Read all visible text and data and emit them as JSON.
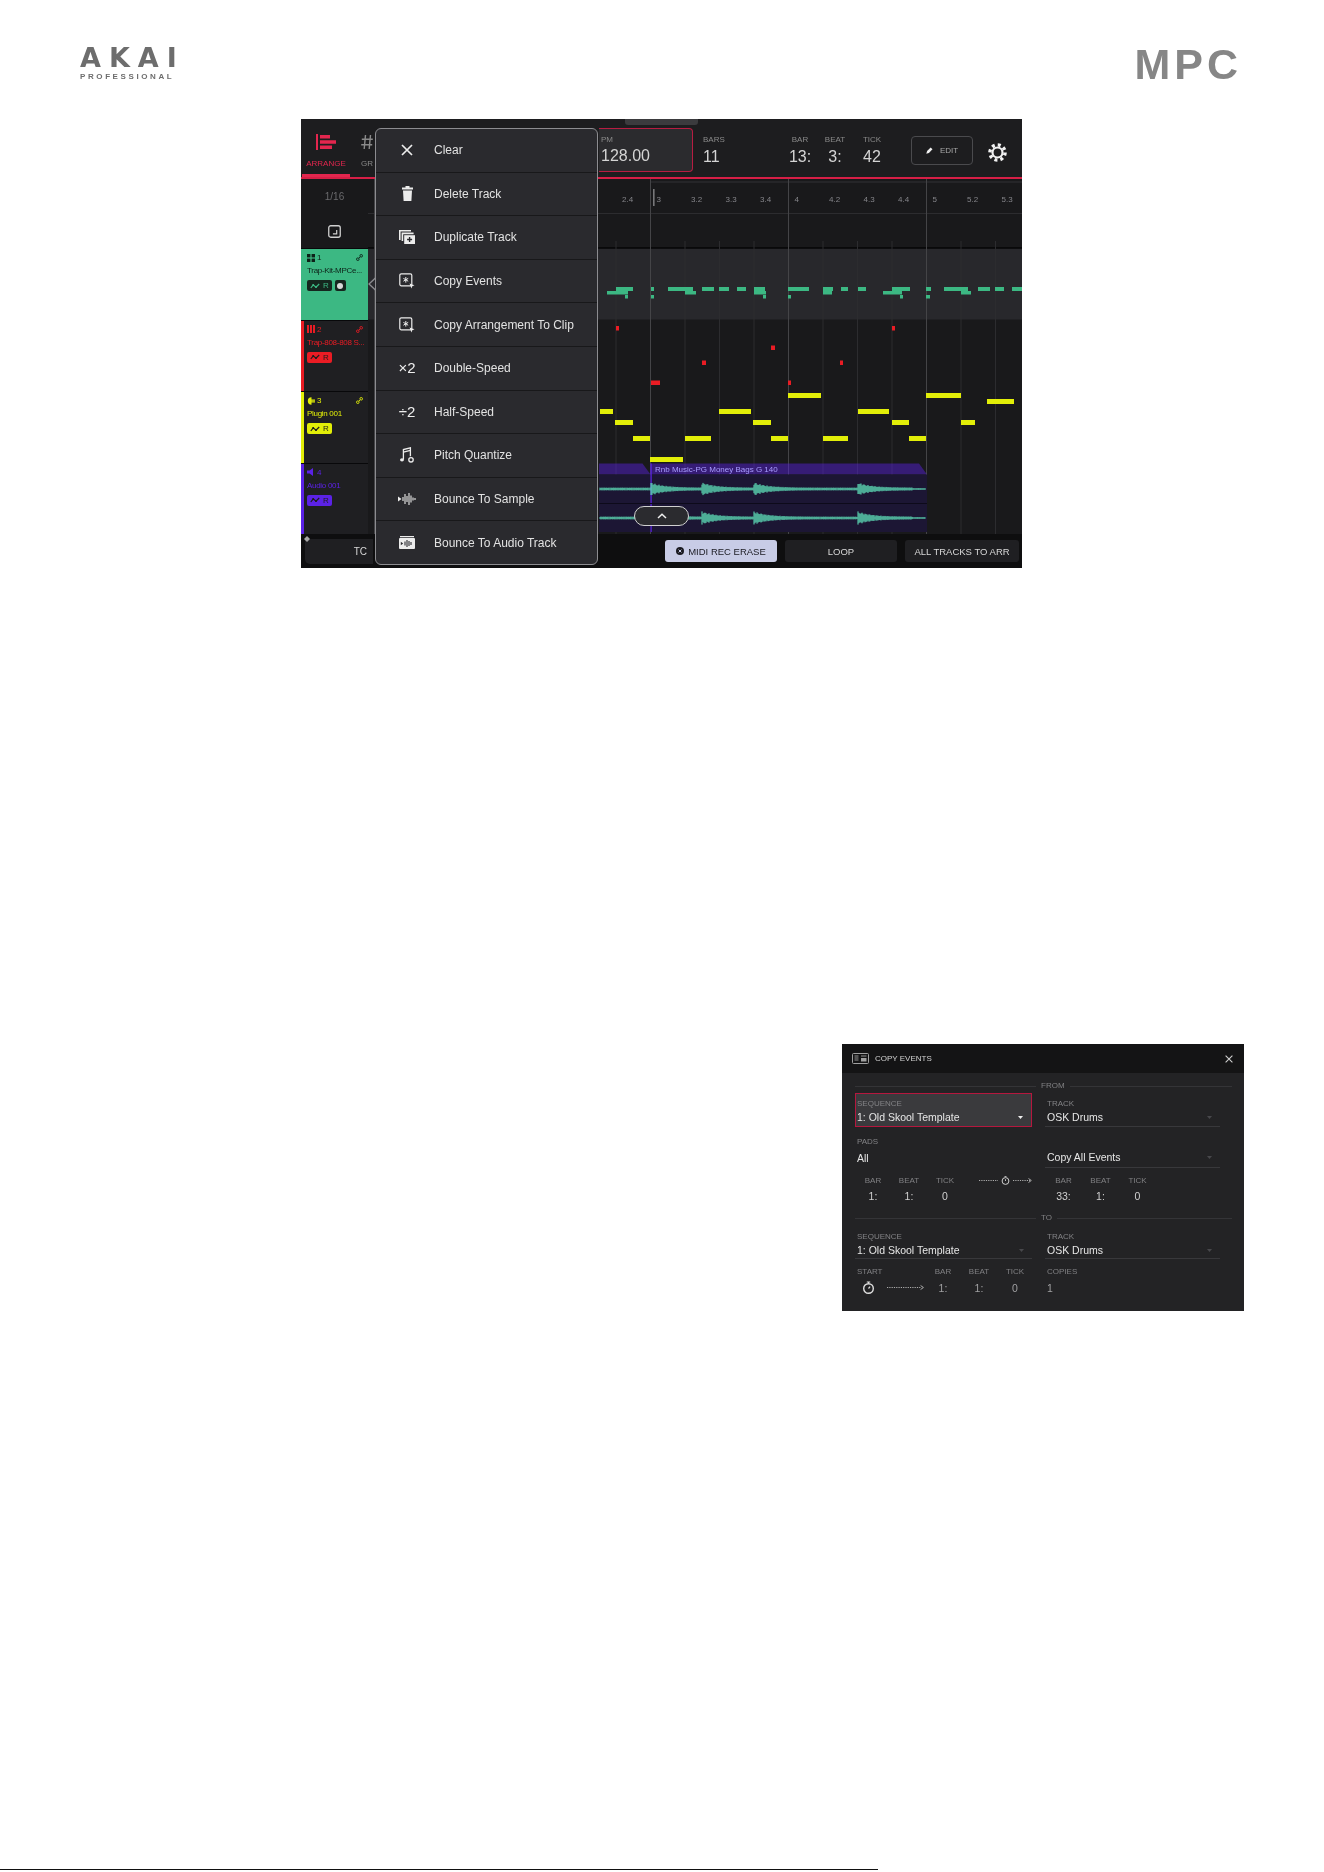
{
  "header": {
    "brand_logo": {
      "name": "AKAI",
      "subtitle": "PROFESSIONAL"
    },
    "product_logo": "MPC"
  },
  "arrange_screen": {
    "tabs": [
      {
        "label": "ARRANGE",
        "selected": true
      },
      {
        "label": "GR",
        "selected": false
      }
    ],
    "bpm": {
      "label": "PM",
      "value": "128.00",
      "selected": true
    },
    "bars": {
      "label": "BARS",
      "value": "11"
    },
    "position": [
      {
        "label": "BAR",
        "value": "13:"
      },
      {
        "label": "BEAT",
        "value": "3:"
      },
      {
        "label": "TICK",
        "value": "42"
      }
    ],
    "edit_button": "EDIT",
    "grid_resolution": "1/16",
    "ruler": [
      "2.4",
      "3",
      "3.2",
      "3.3",
      "3.4",
      "4",
      "4.2",
      "4.3",
      "4.4",
      "5",
      "5.2",
      "5.3"
    ],
    "tracks": [
      {
        "number": "1",
        "name": "Trap-Kit-MPCe...",
        "kind": "drum",
        "color": "#3cb883",
        "selected": true,
        "badge": "R",
        "dot_button": true
      },
      {
        "number": "2",
        "name": "Trap-808-808 S...",
        "kind": "keygroup",
        "color": "#ea1c24",
        "selected": false,
        "badge": "R",
        "dot_button": false
      },
      {
        "number": "3",
        "name": "Plugin 001",
        "kind": "plugin",
        "color": "#e2ee08",
        "selected": false,
        "badge": "R",
        "dot_button": false
      },
      {
        "number": "4",
        "name": "Audio 001",
        "kind": "audio",
        "color": "#5b22e6",
        "selected": false,
        "badge": "R",
        "dot_button": false,
        "clip_title": "Rnb Music-PG Money Bags G 140"
      }
    ],
    "context_menu": [
      {
        "label": "Clear"
      },
      {
        "label": "Delete Track"
      },
      {
        "label": "Duplicate Track"
      },
      {
        "label": "Copy Events"
      },
      {
        "label": "Copy Arrangement To Clip"
      },
      {
        "symbol": "×2",
        "label": "Double-Speed"
      },
      {
        "symbol": "÷2",
        "label": "Half-Speed"
      },
      {
        "label": "Pitch Quantize"
      },
      {
        "label": "Bounce To Sample"
      },
      {
        "label": "Bounce To Audio Track"
      }
    ],
    "bottom_buttons": [
      {
        "label": "TC",
        "on": false
      },
      {
        "label": "MIDI REC ERASE",
        "on": true
      },
      {
        "label": "LOOP",
        "on": false
      },
      {
        "label": "ALL TRACKS TO ARR",
        "on": false
      }
    ]
  },
  "copy_events_dialog": {
    "title": "COPY EVENTS",
    "from": {
      "label": "FROM",
      "sequence": {
        "label": "SEQUENCE",
        "value": "1: Old Skool Template",
        "selected": true
      },
      "track": {
        "label": "TRACK",
        "value": "OSK Drums",
        "selected": false
      },
      "pads": {
        "label": "PADS",
        "value": "All"
      },
      "event_range": {
        "value": "Copy All Events",
        "selected": false
      },
      "start": [
        {
          "label": "BAR",
          "value": "1:"
        },
        {
          "label": "BEAT",
          "value": "1:"
        },
        {
          "label": "TICK",
          "value": "0"
        }
      ],
      "end": [
        {
          "label": "BAR",
          "value": "33:"
        },
        {
          "label": "BEAT",
          "value": "1:"
        },
        {
          "label": "TICK",
          "value": "0"
        }
      ]
    },
    "to": {
      "label": "TO",
      "sequence": {
        "label": "SEQUENCE",
        "value": "1: Old Skool Template",
        "selected": false
      },
      "track": {
        "label": "TRACK",
        "value": "OSK Drums",
        "selected": false
      },
      "start": {
        "label": "START",
        "position": [
          {
            "label": "BAR",
            "value": "1:"
          },
          {
            "label": "BEAT",
            "value": "1:"
          },
          {
            "label": "TICK",
            "value": "0"
          }
        ]
      },
      "copies": {
        "label": "COPIES",
        "value": "1"
      }
    }
  }
}
